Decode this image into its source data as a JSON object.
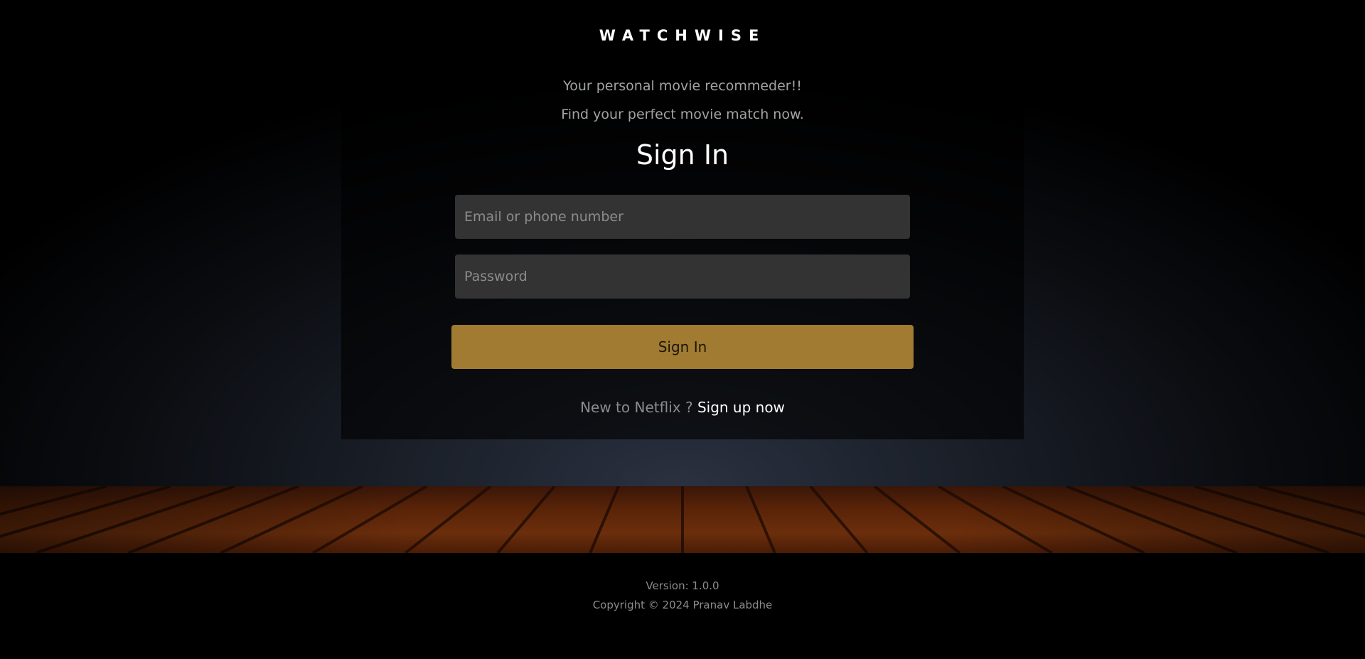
{
  "brand": {
    "name": "WATCHWISE"
  },
  "hero": {
    "tagline_1": "Your personal movie recommeder!!",
    "tagline_2": "Find your perfect movie match now."
  },
  "form": {
    "title": "Sign In",
    "email_placeholder": "Email or phone number",
    "email_value": "",
    "password_placeholder": "Password",
    "password_value": "",
    "submit_label": "Sign In",
    "signup_prompt": "New to Netflix ?",
    "signup_link": "Sign up now"
  },
  "footer": {
    "version": "Version: 1.0.0",
    "copyright": "Copyright © 2024 Pranav Labdhe"
  },
  "colors": {
    "accent": "#a07b31",
    "input_bg": "#333333",
    "background": "#000000",
    "muted_text": "#8c8c8c"
  }
}
